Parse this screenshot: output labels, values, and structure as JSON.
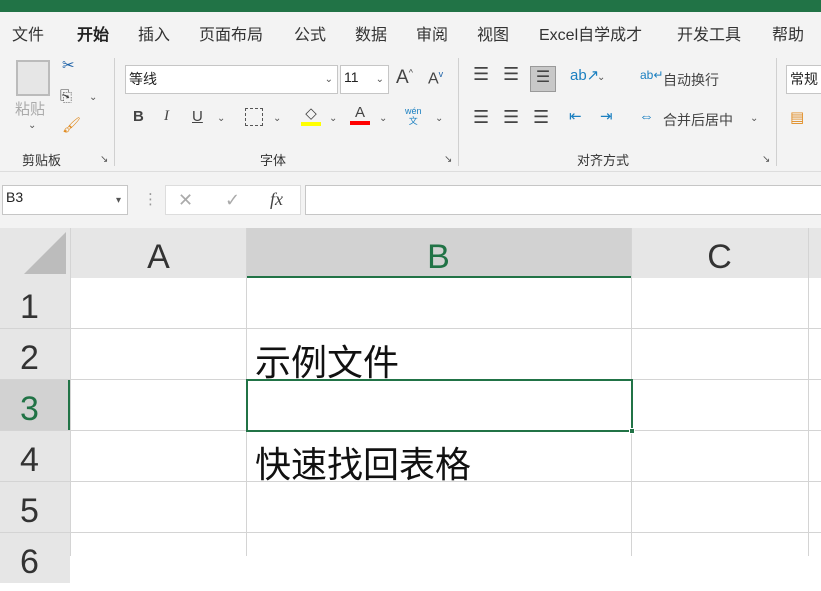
{
  "tabs": [
    "文件",
    "开始",
    "插入",
    "页面布局",
    "公式",
    "数据",
    "审阅",
    "视图",
    "Excel自学成才",
    "开发工具",
    "帮助"
  ],
  "clipboard": {
    "paste": "粘贴",
    "group": "剪贴板"
  },
  "font": {
    "name": "等线",
    "size": "11",
    "group": "字体",
    "phonetic": "wén\n文"
  },
  "align": {
    "wrap": "自动换行",
    "merge": "合并后居中",
    "group": "对齐方式"
  },
  "number": {
    "format": "常规"
  },
  "formula_bar": {
    "name_box": "B3",
    "fx": "fx",
    "value": ""
  },
  "columns": [
    "A",
    "B",
    "C"
  ],
  "rows": [
    "1",
    "2",
    "3",
    "4",
    "5",
    "6"
  ],
  "cells": {
    "B2": "示例文件",
    "B4": "快速找回表格"
  },
  "colors": {
    "accent": "#217346",
    "highlight": "#ffff00",
    "font_color": "#ff0000"
  }
}
